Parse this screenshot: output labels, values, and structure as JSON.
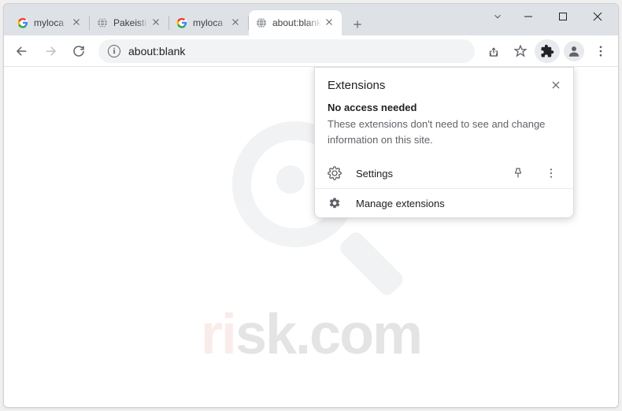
{
  "tabs": [
    {
      "label": "myloca",
      "favicon": "google"
    },
    {
      "label": "Pakeisti",
      "favicon": "globe"
    },
    {
      "label": "myloca",
      "favicon": "google"
    },
    {
      "label": "about:blank",
      "favicon": "globe",
      "active": true
    }
  ],
  "omnibox": {
    "text": "about:blank"
  },
  "popup": {
    "title": "Extensions",
    "subtitle": "No access needed",
    "description": "These extensions don't need to see and change information on this site.",
    "row_settings": "Settings",
    "row_manage": "Manage extensions"
  },
  "watermark": {
    "prefix": "ri",
    "suffix": "sk.com"
  }
}
